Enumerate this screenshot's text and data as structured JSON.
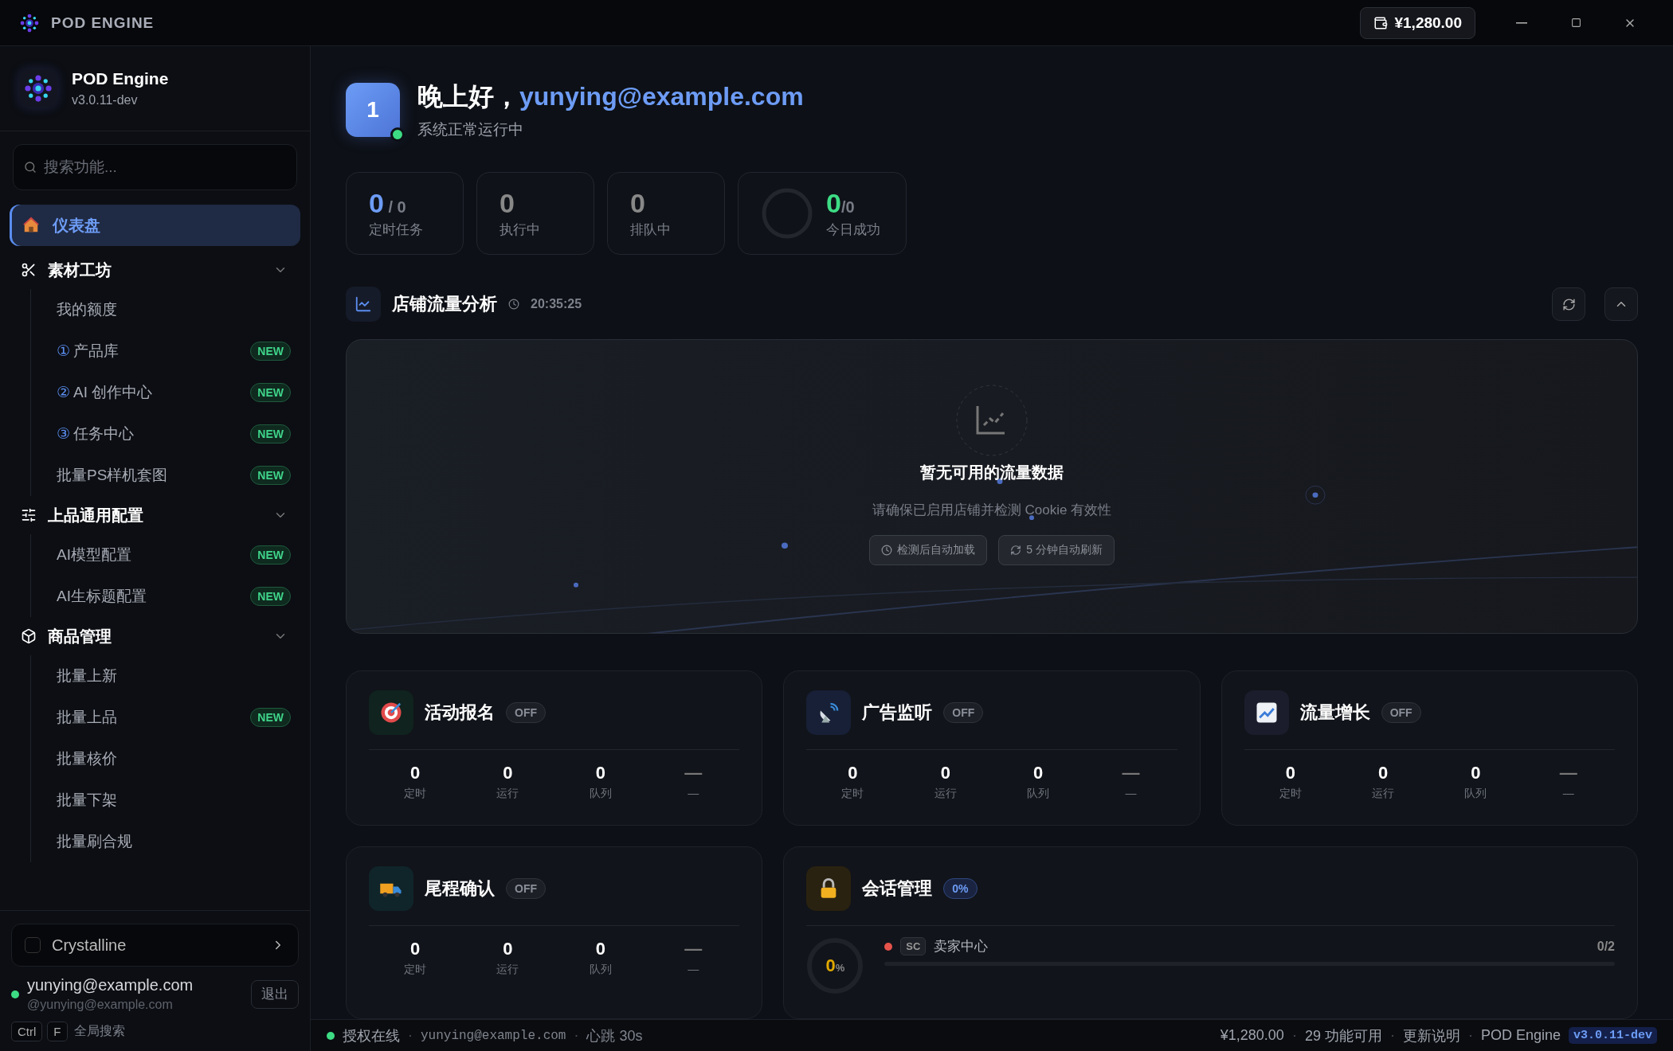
{
  "titlebar": {
    "app_name": "POD ENGINE",
    "balance": "¥1,280.00"
  },
  "sidebar": {
    "brand": {
      "name": "POD Engine",
      "version": "v3.0.11-dev"
    },
    "search": {
      "placeholder": "搜索功能..."
    },
    "nav": [
      {
        "kind": "link",
        "label": "仪表盘",
        "selected": true
      },
      {
        "kind": "group",
        "label": "素材工坊",
        "expanded": true,
        "children": [
          {
            "label": "我的额度",
            "selected": false
          },
          {
            "marker": "①",
            "label": "产品库",
            "badge": "NEW",
            "selected": false
          },
          {
            "marker": "②",
            "label": "AI 创作中心",
            "badge": "NEW",
            "selected": false
          },
          {
            "marker": "③",
            "label": "任务中心",
            "badge": "NEW",
            "selected": false
          },
          {
            "label": "批量PS样机套图",
            "badge": "NEW",
            "selected": false
          }
        ]
      },
      {
        "kind": "group",
        "label": "上品通用配置",
        "expanded": true,
        "children": [
          {
            "label": "AI模型配置",
            "badge": "NEW",
            "selected": false
          },
          {
            "label": "AI生标题配置",
            "badge": "NEW",
            "selected": false
          }
        ]
      },
      {
        "kind": "group",
        "label": "商品管理",
        "expanded": true,
        "children": [
          {
            "label": "批量上新",
            "selected": false
          },
          {
            "label": "批量上品",
            "badge": "NEW",
            "selected": false
          },
          {
            "label": "批量核价",
            "selected": false
          },
          {
            "label": "批量下架",
            "selected": false
          },
          {
            "label": "批量刷合规",
            "selected": false
          }
        ]
      }
    ],
    "theme": {
      "label": "Crystalline",
      "checked": false
    },
    "user": {
      "name": "yunying@example.com",
      "handle": "@yunying@example.com",
      "online": true,
      "logout": "退出"
    },
    "shortcut": {
      "keys": [
        "Ctrl",
        "F"
      ],
      "label": "全局搜索"
    }
  },
  "greeting": {
    "avatar": "1",
    "online": true,
    "hello": "晚上好，",
    "user": "yunying@example.com",
    "status": "系统正常运行中"
  },
  "stats": [
    {
      "kind": "plain",
      "value": "0",
      "total": "/ 0",
      "label": "定时任务",
      "highlight": true
    },
    {
      "kind": "plain",
      "value": "0",
      "label": "执行中",
      "highlight": false
    },
    {
      "kind": "plain",
      "value": "0",
      "label": "排队中",
      "highlight": false
    },
    {
      "kind": "ring",
      "value": "0",
      "total": "/0",
      "label": "今日成功"
    }
  ],
  "traffic": {
    "title": "店铺流量分析",
    "time": "20:35:25",
    "empty_title": "暂无可用的流量数据",
    "empty_hint": "请确保已启用店铺并检测 Cookie 有效性",
    "chips": [
      "检测后自动加载",
      "5 分钟自动刷新"
    ]
  },
  "modules": [
    {
      "title": "活动报名",
      "state": "OFF",
      "metrics": [
        {
          "value": "0",
          "label": "定时"
        },
        {
          "value": "0",
          "label": "运行"
        },
        {
          "value": "0",
          "label": "队列"
        },
        {
          "value": "—",
          "label": "—"
        }
      ]
    },
    {
      "title": "广告监听",
      "state": "OFF",
      "metrics": [
        {
          "value": "0",
          "label": "定时"
        },
        {
          "value": "0",
          "label": "运行"
        },
        {
          "value": "0",
          "label": "队列"
        },
        {
          "value": "—",
          "label": "—"
        }
      ]
    },
    {
      "title": "流量增长",
      "state": "OFF",
      "metrics": [
        {
          "value": "0",
          "label": "定时"
        },
        {
          "value": "0",
          "label": "运行"
        },
        {
          "value": "0",
          "label": "队列"
        },
        {
          "value": "—",
          "label": "—"
        }
      ]
    },
    {
      "title": "尾程确认",
      "state": "OFF",
      "metrics": [
        {
          "value": "0",
          "label": "定时"
        },
        {
          "value": "0",
          "label": "运行"
        },
        {
          "value": "0",
          "label": "队列"
        },
        {
          "value": "—",
          "label": "—"
        }
      ]
    }
  ],
  "session": {
    "title": "会话管理",
    "badge": "0%",
    "ring_value": "0",
    "ring_unit": "%",
    "rows": [
      {
        "code": "SC",
        "label": "卖家中心",
        "count": "0/2",
        "color": "#e5534b"
      }
    ]
  },
  "status_bar": {
    "online": true,
    "left": [
      {
        "kind": "text",
        "text": "授权在线"
      },
      {
        "kind": "sep",
        "text": "·"
      },
      {
        "kind": "mono",
        "text": "yunying@example.com"
      },
      {
        "kind": "sep",
        "text": "·"
      },
      {
        "kind": "muted",
        "text": "心跳 30s"
      }
    ],
    "right": [
      {
        "kind": "text",
        "text": "¥1,280.00"
      },
      {
        "kind": "sep",
        "text": "·"
      },
      {
        "kind": "text",
        "text": "29 功能可用"
      },
      {
        "kind": "sep",
        "text": "·"
      },
      {
        "kind": "link",
        "text": "更新说明"
      },
      {
        "kind": "sep",
        "text": "·"
      },
      {
        "kind": "text",
        "text": "POD Engine"
      },
      {
        "kind": "version",
        "text": "v3.0.11-dev"
      }
    ]
  }
}
